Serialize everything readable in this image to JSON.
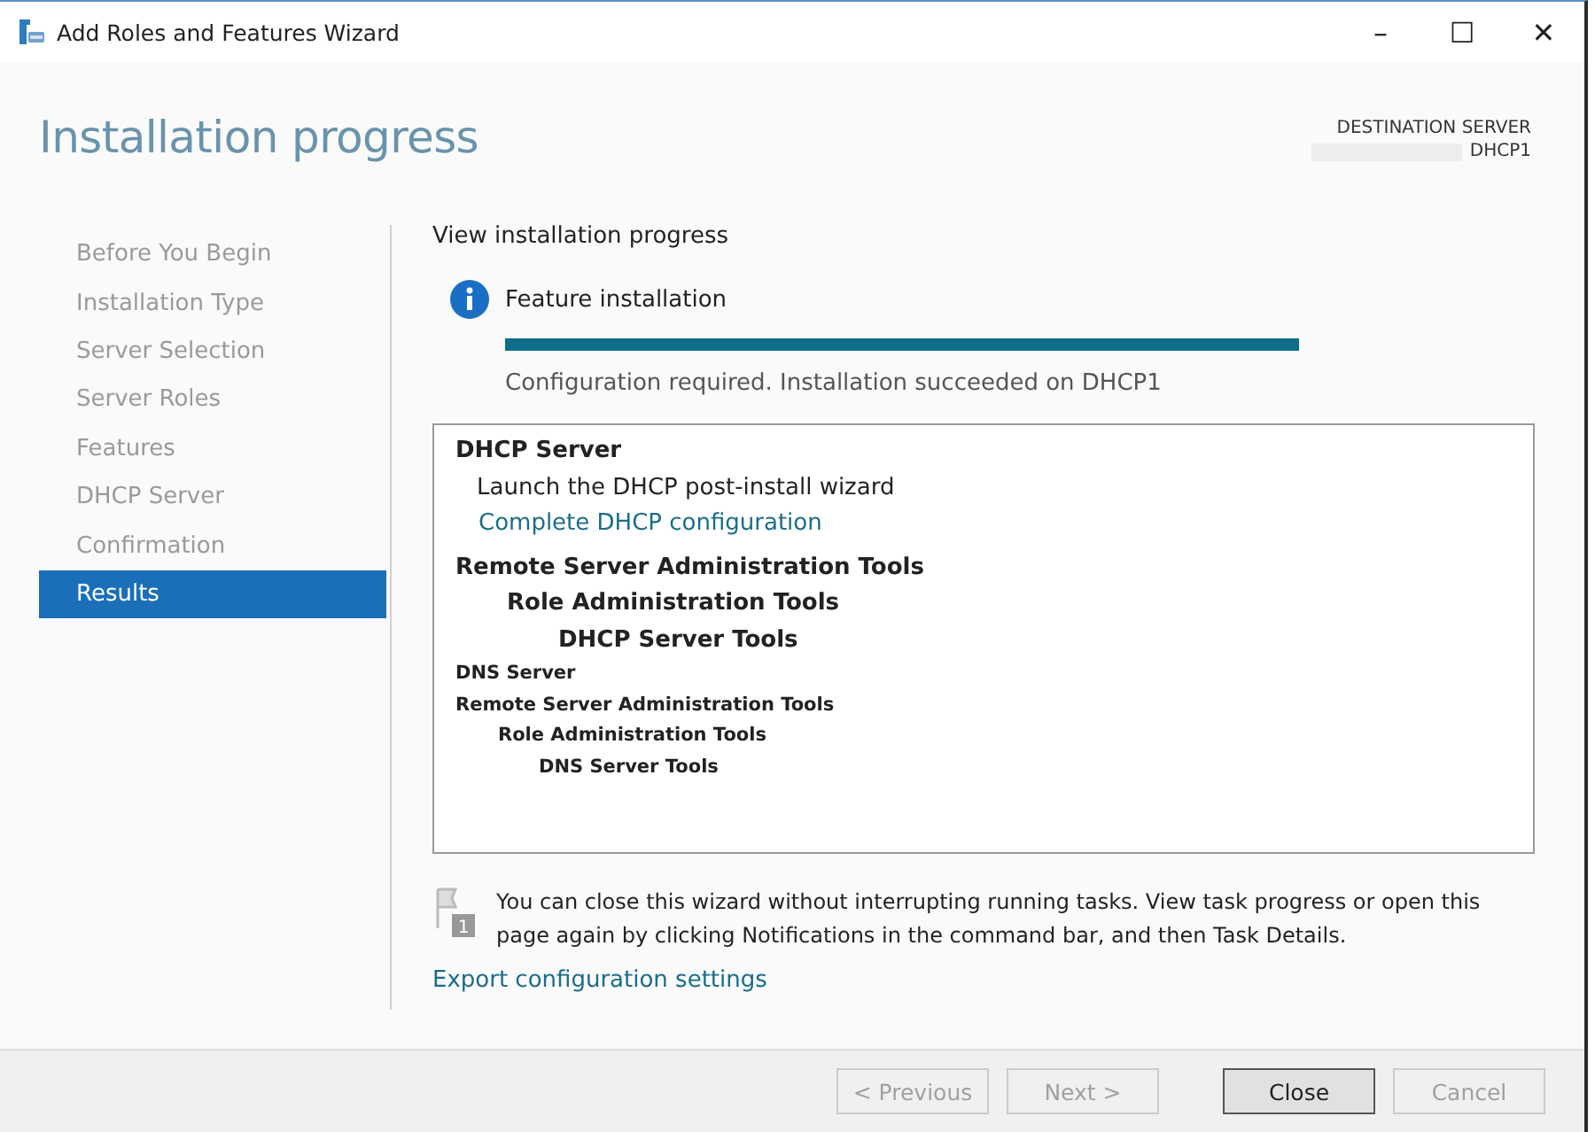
{
  "window": {
    "title": "Add Roles and Features Wizard",
    "controls": [
      "–",
      "☐",
      "✕"
    ]
  },
  "header": {
    "title": "Installation progress",
    "destination_label": "DESTINATION SERVER",
    "destination_server": "DHCP1"
  },
  "sidebar": {
    "items": [
      {
        "label": "Before You Begin",
        "selected": false
      },
      {
        "label": "Installation Type",
        "selected": false
      },
      {
        "label": "Server Selection",
        "selected": false
      },
      {
        "label": "Server Roles",
        "selected": false
      },
      {
        "label": "Features",
        "selected": false
      },
      {
        "label": "DHCP Server",
        "selected": false
      },
      {
        "label": "Confirmation",
        "selected": false
      },
      {
        "label": "Results",
        "selected": true
      }
    ]
  },
  "content": {
    "heading": "View installation progress",
    "status_title": "Feature installation",
    "progress": {
      "level": 1
    },
    "status_message": "Configuration required. Installation succeeded on DHCP1",
    "results": [
      {
        "text": "DHCP Server",
        "kind": "title",
        "children": [
          {
            "text": "Launch the DHCP post-install wizard",
            "kind": "text",
            "children": [
              {
                "text": "Complete DHCP configuration",
                "kind": "link"
              }
            ]
          }
        ]
      },
      {
        "text": "Remote Server Administration Tools",
        "kind": "title",
        "children": [
          {
            "text": "Role Administration Tools",
            "kind": "title",
            "children": [
              {
                "text": "DHCP Server Tools",
                "kind": "title"
              }
            ]
          }
        ]
      },
      {
        "text": "DNS Server",
        "kind": "small"
      },
      {
        "text": "Remote Server Administration Tools",
        "kind": "small",
        "children": [
          {
            "text": "Role Administration Tools",
            "kind": "small",
            "children": [
              {
                "text": "DNS Server Tools",
                "kind": "small"
              }
            ]
          }
        ]
      }
    ],
    "notice_badge": "1",
    "notice": "You can close this wizard without interrupting running tasks. View task progress or open this page again by clicking Notifications in the command bar, and then Task Details.",
    "export_link": "Export configuration settings"
  },
  "buttons": [
    {
      "label": "< Previous",
      "disabled": true,
      "default": false
    },
    {
      "label": "Next >",
      "disabled": true,
      "default": false
    },
    {
      "label": "Close",
      "disabled": false,
      "default": true
    },
    {
      "label": "Cancel",
      "disabled": true,
      "default": false
    }
  ]
}
